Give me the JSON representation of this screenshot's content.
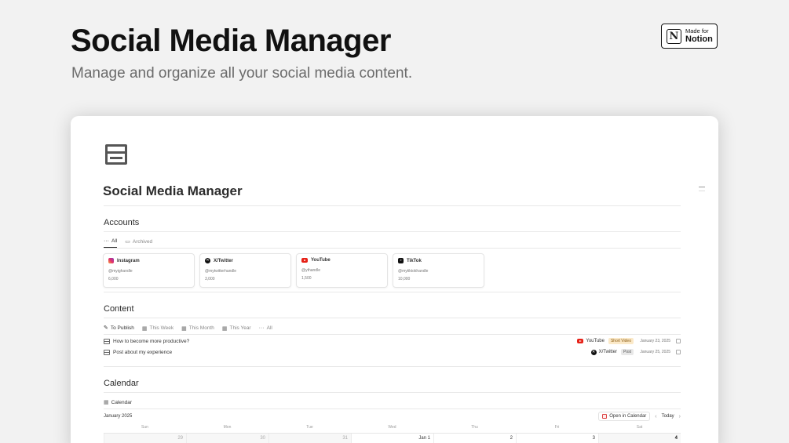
{
  "hero": {
    "title": "Social Media Manager",
    "subtitle": "Manage and organize all your social media content."
  },
  "badge": {
    "small": "Made for",
    "big": "Notion",
    "logo_letter": "N"
  },
  "page": {
    "title": "Social Media Manager"
  },
  "accounts": {
    "title": "Accounts",
    "tabs": [
      {
        "label": "All",
        "icon": "dots-icon"
      },
      {
        "label": "Archived",
        "icon": "archive-icon"
      }
    ],
    "cards": [
      {
        "name": "Instagram",
        "handle": "@myighandle",
        "count": "6,000",
        "icon": "instagram-icon"
      },
      {
        "name": "X/Twitter",
        "handle": "@mytwitterhandle",
        "count": "3,000",
        "icon": "x-icon"
      },
      {
        "name": "YouTube",
        "handle": "@ythandle",
        "count": "1,500",
        "icon": "youtube-icon"
      },
      {
        "name": "TikTok",
        "handle": "@mytiktokhandle",
        "count": "10,000",
        "icon": "tiktok-icon"
      }
    ]
  },
  "content": {
    "title": "Content",
    "tabs": [
      {
        "label": "To Publish",
        "icon": "pin-icon"
      },
      {
        "label": "This Week",
        "icon": "calendar-icon"
      },
      {
        "label": "This Month",
        "icon": "calendar-icon"
      },
      {
        "label": "This Year",
        "icon": "calendar-icon"
      },
      {
        "label": "All",
        "icon": "dots-icon"
      }
    ],
    "rows": [
      {
        "title": "How to become more productive?",
        "platform": "YouTube",
        "type": "Short Video",
        "date": "January 23, 2025"
      },
      {
        "title": "Post about my experience",
        "platform": "X/Twitter",
        "type": "Post",
        "date": "January 25, 2025"
      }
    ]
  },
  "calendar": {
    "title": "Calendar",
    "view_tab": "Calendar",
    "month": "January 2025",
    "open_label": "Open in Calendar",
    "today_label": "Today",
    "weekdays": [
      "Sun",
      "Mon",
      "Tue",
      "Wed",
      "Thu",
      "Fri",
      "Sat"
    ],
    "first_week": [
      "29",
      "30",
      "31",
      "Jan 1",
      "2",
      "3",
      "4"
    ]
  }
}
